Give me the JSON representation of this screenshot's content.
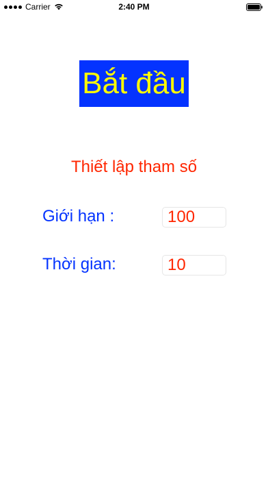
{
  "status_bar": {
    "carrier": "Carrier",
    "time": "2:40 PM",
    "icons": [
      "signal-icon",
      "wifi-icon",
      "battery-icon"
    ]
  },
  "start_button": {
    "label": "Bắt đầu",
    "bg": "#0433ff",
    "color": "#fffb00"
  },
  "settings": {
    "title": "Thiết lập tham số",
    "limit": {
      "label": "Giới hạn :",
      "value": "100"
    },
    "time": {
      "label": "Thời gian:",
      "value": "10"
    }
  },
  "colors": {
    "title": "#ff2600",
    "labels": "#0433ff",
    "values": "#ff2600"
  }
}
